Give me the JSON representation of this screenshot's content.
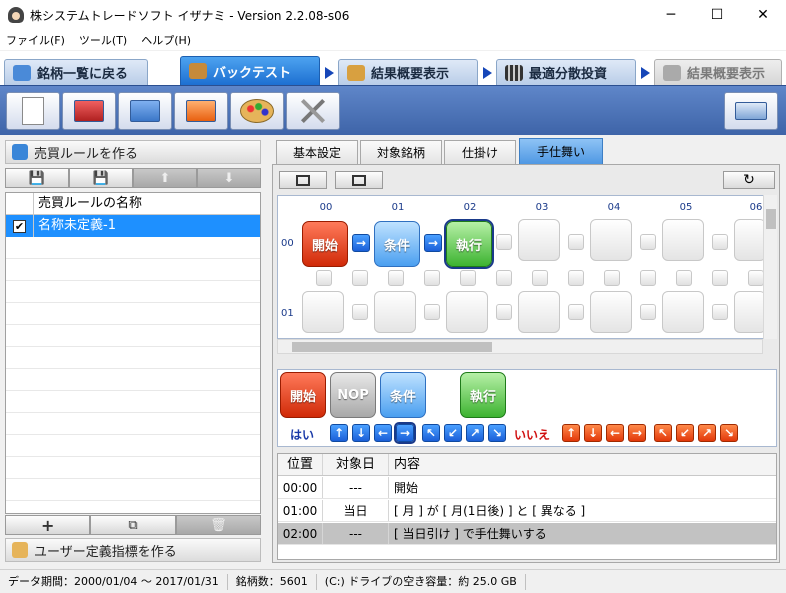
{
  "window": {
    "title": "株システムトレードソフト イザナミ - Version 2.2.08-s06",
    "minimize": "─",
    "maximize": "☐",
    "close": "✕"
  },
  "menu": [
    "ファイル(F)",
    "ツール(T)",
    "ヘルプ(H)"
  ],
  "nav": {
    "tabs": [
      {
        "label": "銘柄一覧に戻る",
        "state": "normal"
      },
      {
        "label": "バックテスト",
        "state": "active"
      },
      {
        "label": "結果概要表示",
        "state": "normal"
      },
      {
        "label": "最適分散投資",
        "state": "normal"
      },
      {
        "label": "結果概要表示",
        "state": "disabled"
      }
    ]
  },
  "toolbar": {
    "icons": [
      "new-document-icon",
      "machine-icon",
      "export-icon",
      "import-icon",
      "palette-icon",
      "tools-icon",
      "save-tray-icon"
    ]
  },
  "left": {
    "rule_section_title": "売買ルールを作る",
    "rule_buttons": [
      "💾",
      "💾",
      "⬆",
      "⬇"
    ],
    "list_header": "売買ルールの名称",
    "rules": [
      {
        "name": "名称未定義-1",
        "checked": true,
        "check_mark": "✔"
      }
    ],
    "list_buttons": [
      "+",
      "⧉",
      "🗑"
    ],
    "indicator_section_title": "ユーザー定義指標を作る"
  },
  "right": {
    "subtabs": [
      "基本設定",
      "対象銘柄",
      "仕掛け",
      "手仕舞い"
    ],
    "active_subtab": "手仕舞い",
    "refresh_icon": "↻",
    "grid": {
      "columns": [
        "00",
        "01",
        "02",
        "03",
        "04",
        "05",
        "06"
      ],
      "rows": [
        "00",
        "01"
      ],
      "blocks": [
        {
          "label": "開始",
          "type": "start"
        },
        {
          "label": "条件",
          "type": "cond"
        },
        {
          "label": "執行",
          "type": "exec"
        }
      ]
    },
    "palette": {
      "blocks": [
        "開始",
        "NOP",
        "条件",
        "執行"
      ],
      "yes_label": "はい",
      "no_label": "いいえ",
      "yes_arrows": [
        "↑",
        "↓",
        "←",
        "→",
        "↖",
        "↙",
        "↗",
        "↘"
      ],
      "no_arrows": [
        "↑",
        "↓",
        "←",
        "→",
        "↖",
        "↙",
        "↗",
        "↘"
      ]
    },
    "table": {
      "headers": [
        "位置",
        "対象日",
        "内容"
      ],
      "rows": [
        {
          "pos": "00:00",
          "day": "---",
          "content": "開始"
        },
        {
          "pos": "01:00",
          "day": "当日",
          "content": "[ 月 ] が [ 月(1日後) ] と [ 異なる ]"
        },
        {
          "pos": "02:00",
          "day": "---",
          "content": "[ 当日引け ] で手仕舞いする"
        }
      ]
    }
  },
  "status": {
    "period": "データ期間：2000/01/04 〜 2017/01/31",
    "count": "銘柄数：5601",
    "disk": "(C:) ドライブの空き容量：約 25.0 GB"
  }
}
